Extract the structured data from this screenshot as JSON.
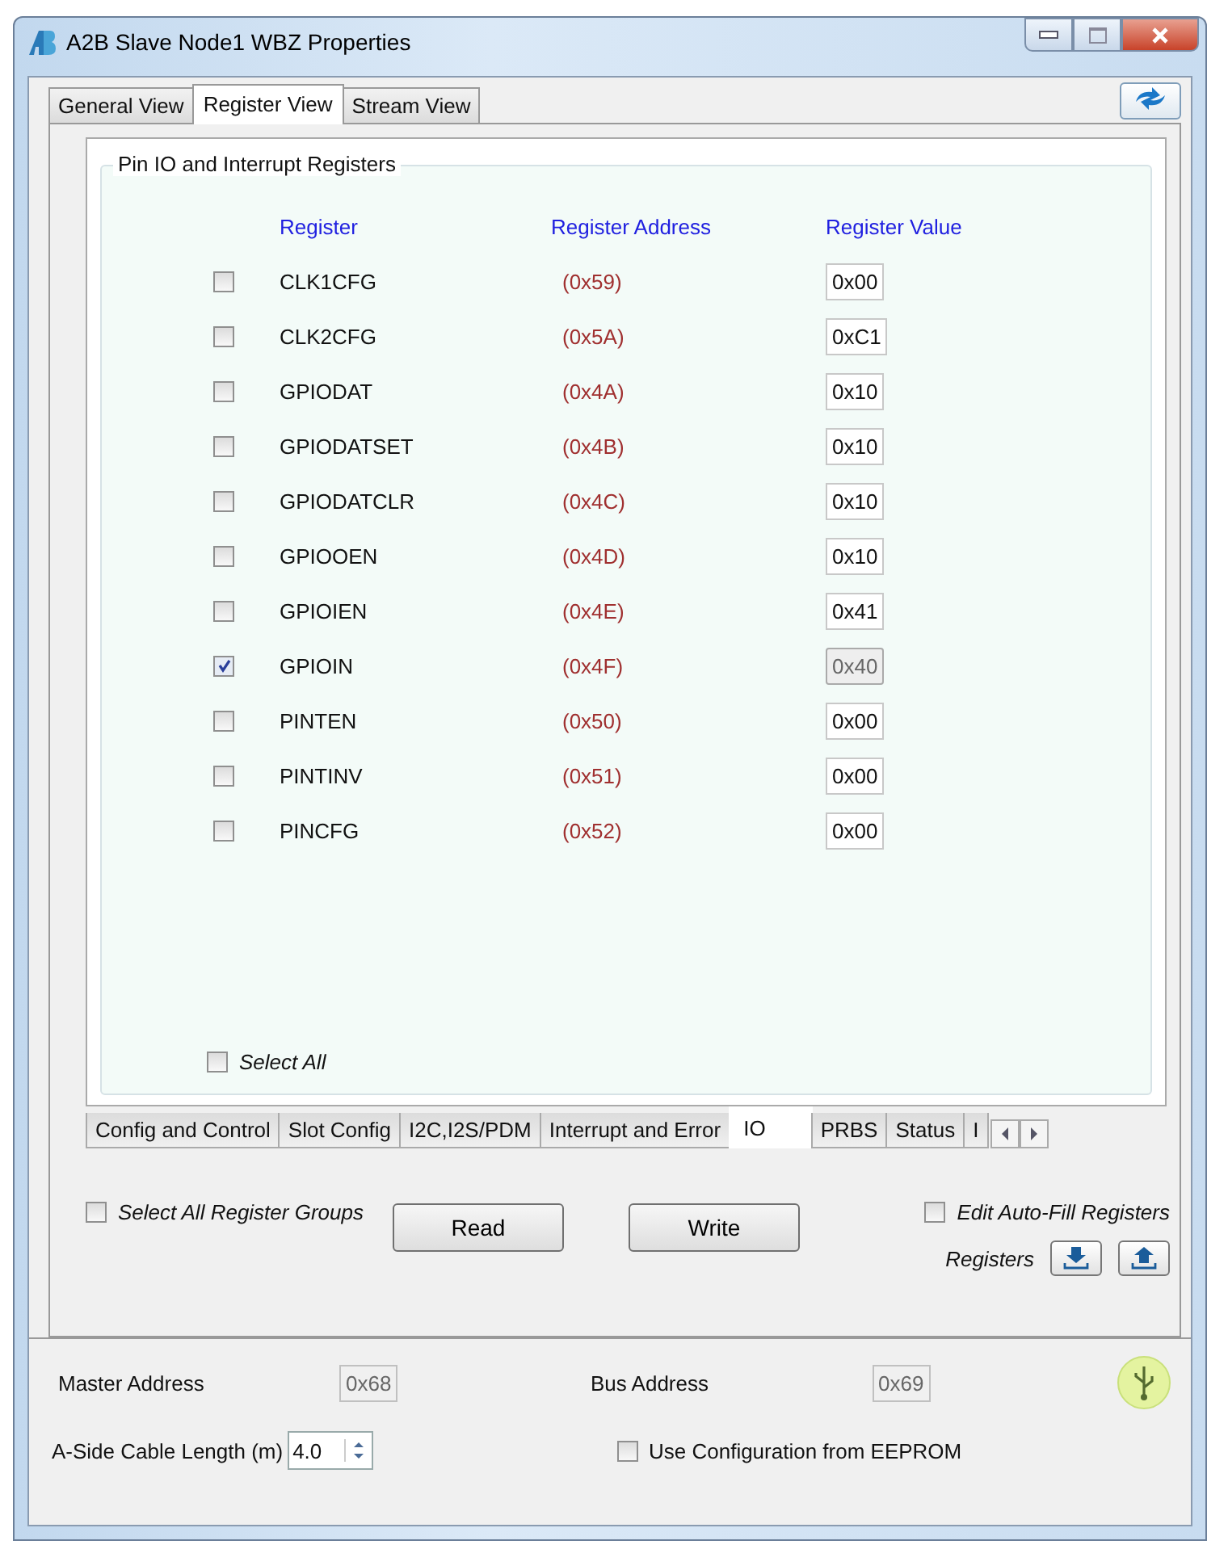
{
  "window": {
    "title": "A2B Slave Node1 WBZ Properties"
  },
  "tabs": [
    {
      "label": "General View",
      "selected": false
    },
    {
      "label": "Register View",
      "selected": true
    },
    {
      "label": "Stream View",
      "selected": false
    }
  ],
  "group": {
    "title": "Pin IO and Interrupt Registers",
    "columns": [
      "Register",
      "Register Address",
      "Register Value"
    ],
    "rows": [
      {
        "name": "CLK1CFG",
        "address": "(0x59)",
        "value": "0x00",
        "checked": false
      },
      {
        "name": "CLK2CFG",
        "address": "(0x5A)",
        "value": "0xC1",
        "checked": false
      },
      {
        "name": "GPIODAT",
        "address": "(0x4A)",
        "value": "0x10",
        "checked": false
      },
      {
        "name": "GPIODATSET",
        "address": "(0x4B)",
        "value": "0x10",
        "checked": false
      },
      {
        "name": "GPIODATCLR",
        "address": "(0x4C)",
        "value": "0x10",
        "checked": false
      },
      {
        "name": "GPIOOEN",
        "address": "(0x4D)",
        "value": "0x10",
        "checked": false
      },
      {
        "name": "GPIOIEN",
        "address": "(0x4E)",
        "value": "0x41",
        "checked": false
      },
      {
        "name": "GPIOIN",
        "address": "(0x4F)",
        "value": "0x40",
        "checked": true
      },
      {
        "name": "PINTEN",
        "address": "(0x50)",
        "value": "0x00",
        "checked": false
      },
      {
        "name": "PINTINV",
        "address": "(0x51)",
        "value": "0x00",
        "checked": false
      },
      {
        "name": "PINCFG",
        "address": "(0x52)",
        "value": "0x00",
        "checked": false
      }
    ],
    "select_all": {
      "label": "Select All",
      "checked": false
    }
  },
  "group_tabs": [
    {
      "label": "Config and Control",
      "selected": false
    },
    {
      "label": "Slot Config",
      "selected": false
    },
    {
      "label": "I2C,I2S/PDM",
      "selected": false
    },
    {
      "label": "Interrupt and Error",
      "selected": false
    },
    {
      "label": "IO",
      "selected": true
    },
    {
      "label": "PRBS",
      "selected": false
    },
    {
      "label": "Status",
      "selected": false
    },
    {
      "label": "I",
      "selected": false
    }
  ],
  "actions": {
    "select_all_groups": {
      "label": "Select All Register Groups",
      "checked": false
    },
    "read": "Read",
    "write": "Write",
    "edit_autofill": {
      "label": "Edit Auto-Fill Registers",
      "checked": false
    },
    "registers_label": "Registers"
  },
  "footer": {
    "master_address_label": "Master Address",
    "master_address": "0x68",
    "bus_address_label": "Bus Address",
    "bus_address": "0x69",
    "cable_label": "A-Side Cable Length (m)",
    "cable_value": "4.0",
    "eeprom": {
      "label": "Use Configuration from EEPROM",
      "checked": false
    }
  }
}
